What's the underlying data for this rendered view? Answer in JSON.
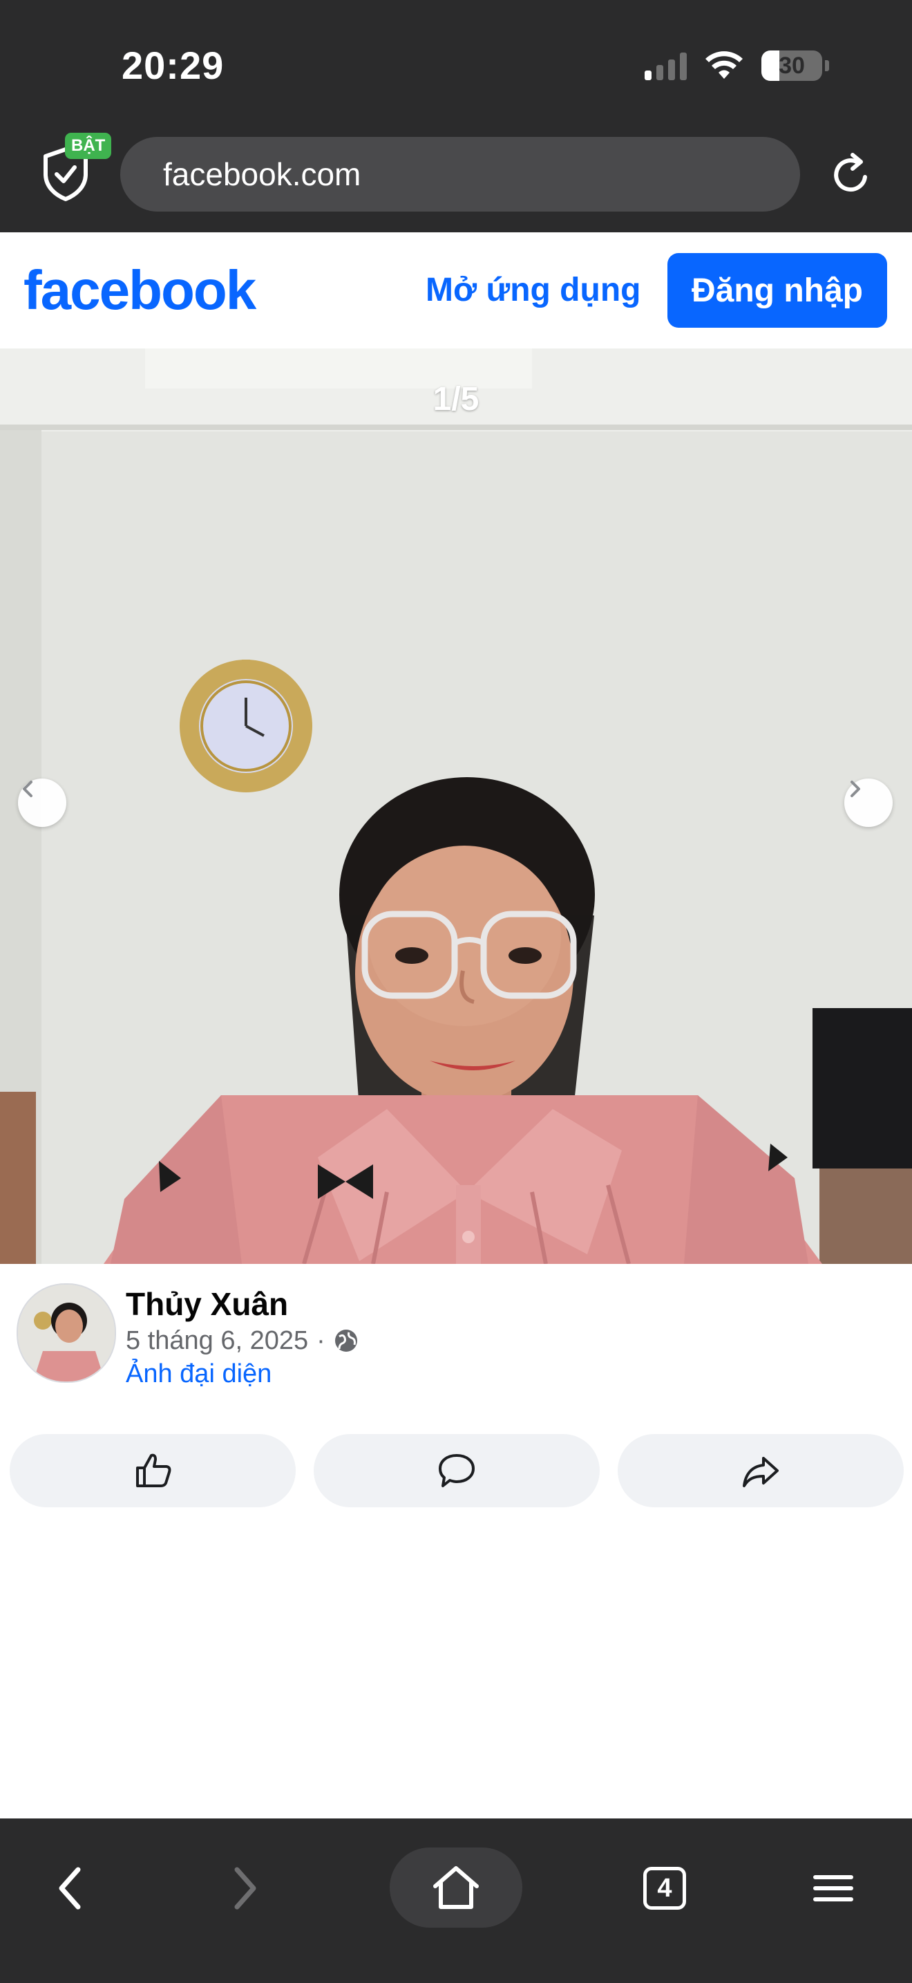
{
  "status_bar": {
    "time": "20:29",
    "battery_level": "30"
  },
  "browser": {
    "security_badge": "BẬT",
    "url": "facebook.com",
    "open_tabs_count": "4"
  },
  "fb_header": {
    "logo_text": "facebook",
    "open_app_label": "Mở ứng dụng",
    "login_label": "Đăng nhập",
    "brand_color": "#0866ff"
  },
  "photo_viewer": {
    "counter": "1/5"
  },
  "post": {
    "author": "Thủy Xuân",
    "date": "5 tháng 6, 2025",
    "separator": "·",
    "privacy_icon": "globe-icon",
    "album": "Ảnh đại diện"
  },
  "actions": [
    {
      "name": "like",
      "icon": "thumbs-up-icon"
    },
    {
      "name": "comment",
      "icon": "comment-icon"
    },
    {
      "name": "share",
      "icon": "share-icon"
    }
  ],
  "toolbar_icons": [
    "back-icon",
    "forward-icon",
    "home-icon",
    "tabs-icon",
    "menu-icon"
  ]
}
